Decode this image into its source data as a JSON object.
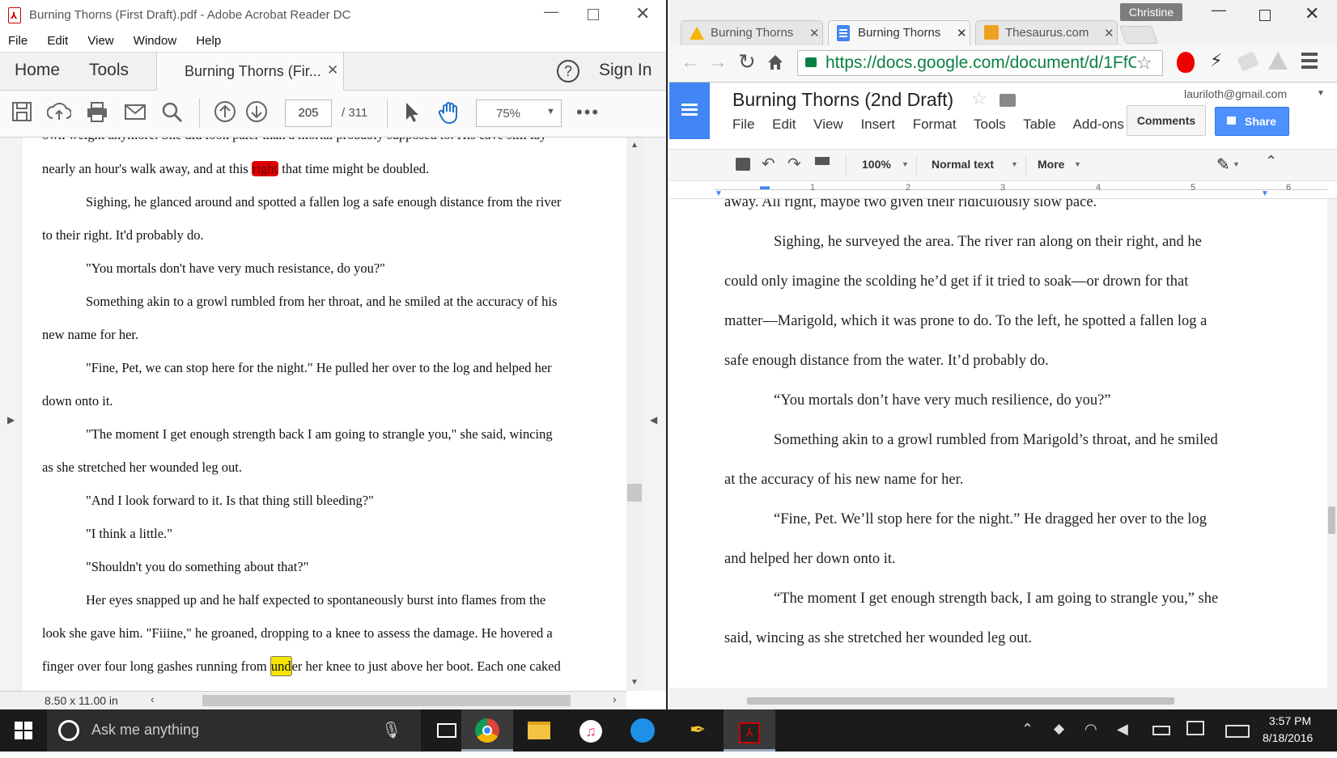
{
  "acrobat": {
    "title": "Burning Thorns (First Draft).pdf - Adobe Acrobat Reader DC",
    "menu": [
      "File",
      "Edit",
      "View",
      "Window",
      "Help"
    ],
    "nav": {
      "home": "Home",
      "tools": "Tools",
      "doc_tab": "Burning Thorns (Fir...",
      "sign_in": "Sign In"
    },
    "page_current": "205",
    "page_total": "/ 311",
    "zoom": "75%",
    "page_size": "8.50 x 11.00 in",
    "lines": [
      {
        "text": "own weight anymore. She did look paler than a mortal probably supposed to. His cave still lay",
        "cut": true
      },
      {
        "text": "nearly an hour's walk away, and at this ",
        "hl": "right",
        "rest": " that time might be doubled."
      },
      {
        "text": "Sighing, he glanced around and spotted a fallen log a safe enough distance from the river",
        "indent": true
      },
      {
        "text": "to their right. It'd probably do."
      },
      {
        "text": "\"You mortals don't have very much resistance, do you?\"",
        "indent": true
      },
      {
        "text": "Something akin to a growl rumbled from her throat, and he smiled at the accuracy of his",
        "indent": true
      },
      {
        "text": "new name for her."
      },
      {
        "text": "\"Fine, Pet, we can stop here for the night.\" He pulled her over to the log and helped her",
        "indent": true
      },
      {
        "text": "down onto it."
      },
      {
        "text": "\"The moment I get enough strength back I am going to strangle you,\" she said, wincing",
        "indent": true
      },
      {
        "text": "as she stretched her wounded leg out."
      },
      {
        "text": "\"And I look forward to it. Is that thing still bleeding?\"",
        "indent": true
      },
      {
        "text": "\"I think a little.\"",
        "indent": true
      },
      {
        "text": "\"Shouldn't you do something about that?\"",
        "indent": true
      },
      {
        "text": "Her eyes snapped up and he half expected to spontaneously burst into flames from the",
        "indent": true
      },
      {
        "text": "look she gave him. \"Fiiine,\" he groaned, dropping to a knee to assess the damage. He hovered a"
      },
      {
        "text": "finger over four long gashes running from ",
        "note": "und",
        "rest": "er her knee to just above her boot. Each one caked"
      }
    ]
  },
  "chrome": {
    "tabs": [
      "Burning Thorns",
      "Burning Thorns",
      "Thesaurus.com"
    ],
    "profile": "Christine",
    "url": "https://docs.google.com/document/d/1FfC",
    "doc_title": "Burning Thorns (2nd Draft)",
    "account": "lauriloth@gmail.com",
    "menu": [
      "File",
      "Edit",
      "View",
      "Insert",
      "Format",
      "Tools",
      "Table",
      "Add-ons"
    ],
    "comments": "Comments",
    "share": "Share",
    "zoom": "100%",
    "style": "Normal text",
    "more": "More",
    "ruler": [
      "1",
      "2",
      "3",
      "4",
      "5",
      "6"
    ],
    "lines": [
      {
        "text": "away. All right, maybe two given their ridiculously slow pace."
      },
      {
        "text": "Sighing, he surveyed the area. The river ran along on their right, and he",
        "indent": true
      },
      {
        "text": "could only imagine the scolding he’d get if it tried to soak—or drown for that"
      },
      {
        "text": "matter—Marigold, which it was prone to do. To the left, he spotted a fallen log a"
      },
      {
        "text": "safe enough distance from the water. It’d probably do."
      },
      {
        "text": "“You mortals don’t have very much resilience, do you?”",
        "indent": true
      },
      {
        "text": "Something akin to a growl rumbled from Marigold’s throat, and he smiled",
        "indent": true
      },
      {
        "text": "at the accuracy of his new name for her."
      },
      {
        "text": "“Fine, Pet. We’ll stop here for the night.” He dragged her over to the log",
        "indent": true
      },
      {
        "text": "and helped her down onto it."
      },
      {
        "text": "“The moment I get enough strength back, I am going to strangle you,” she",
        "indent": true
      },
      {
        "text": "said, wincing as she stretched her wounded leg out."
      }
    ]
  },
  "taskbar": {
    "search": "Ask me anything",
    "time": "3:57 PM",
    "date": "8/18/2016"
  },
  "colors": {
    "highlight_red": "#e00000",
    "note_yellow": "#f5e400",
    "docs_blue": "#4285f4",
    "share_blue": "#4d90fe"
  }
}
